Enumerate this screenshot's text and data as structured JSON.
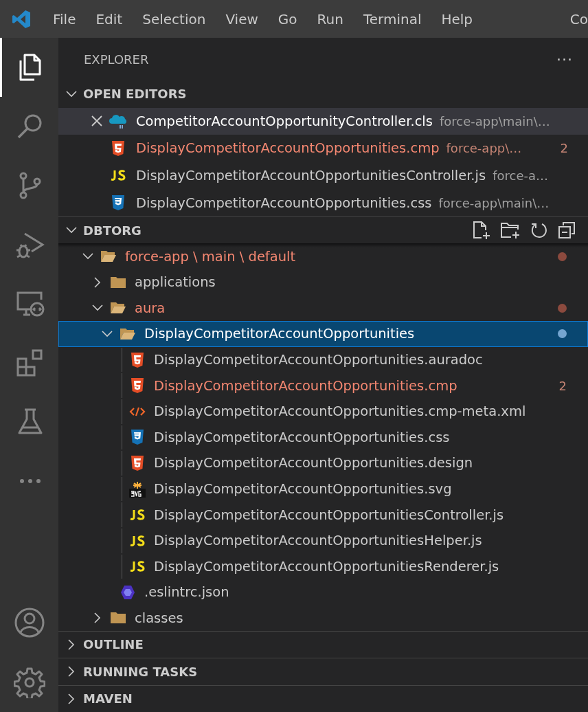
{
  "menu_bar": {
    "items": [
      "File",
      "Edit",
      "Selection",
      "View",
      "Go",
      "Run",
      "Terminal",
      "Help"
    ],
    "title": "Co"
  },
  "activity_bar": {
    "items": [
      {
        "kind": "explorer",
        "selected": true
      },
      {
        "kind": "search",
        "selected": false
      },
      {
        "kind": "source-control",
        "selected": false
      },
      {
        "kind": "run-debug",
        "selected": false
      },
      {
        "kind": "remote",
        "selected": false
      },
      {
        "kind": "extensions",
        "selected": false
      },
      {
        "kind": "testing",
        "selected": false
      },
      {
        "kind": "more",
        "selected": false
      }
    ],
    "bottom": [
      {
        "kind": "account"
      },
      {
        "kind": "settings"
      }
    ]
  },
  "sidebar": {
    "title": "EXPLORER",
    "more": "···",
    "open_editors": {
      "title": "OPEN EDITORS",
      "expanded": true,
      "items": [
        {
          "label": "CompetitorAccountOpportunityController.cls",
          "path": "force-app\\main\\…",
          "kind": "apex",
          "selected": true,
          "modified": false
        },
        {
          "label": "DisplayCompetitorAccountOpportunities.cmp",
          "path": "force-app\\…",
          "kind": "html",
          "selected": false,
          "modified": true,
          "badge": "2"
        },
        {
          "label": "DisplayCompetitorAccountOpportunitiesController.js",
          "path": "force-a…",
          "kind": "js",
          "selected": false,
          "modified": false
        },
        {
          "label": "DisplayCompetitorAccountOpportunities.css",
          "path": "force-app\\main\\…",
          "kind": "css",
          "selected": false,
          "modified": false
        }
      ]
    },
    "workspace": {
      "title": "DBTORG",
      "expanded": true,
      "tree": [
        {
          "label": "force-app \\ main \\ default",
          "kind": "folder",
          "expanded": true,
          "modified": true,
          "selected": false,
          "children": [
            {
              "label": "applications",
              "kind": "folder",
              "expanded": false,
              "modified": false,
              "selected": false
            },
            {
              "label": "aura",
              "kind": "folder",
              "expanded": true,
              "modified": true,
              "selected": false,
              "children": [
                {
                  "label": "DisplayCompetitorAccountOpportunities",
                  "kind": "folder",
                  "expanded": true,
                  "modified": true,
                  "selected": true,
                  "children": [
                    {
                      "label": "DisplayCompetitorAccountOpportunities.auradoc",
                      "kind": "html",
                      "modified": false,
                      "selected": false
                    },
                    {
                      "label": "DisplayCompetitorAccountOpportunities.cmp",
                      "kind": "html",
                      "modified": true,
                      "selected": false,
                      "badge": "2"
                    },
                    {
                      "label": "DisplayCompetitorAccountOpportunities.cmp-meta.xml",
                      "kind": "xml",
                      "modified": false,
                      "selected": false
                    },
                    {
                      "label": "DisplayCompetitorAccountOpportunities.css",
                      "kind": "css",
                      "modified": false,
                      "selected": false
                    },
                    {
                      "label": "DisplayCompetitorAccountOpportunities.design",
                      "kind": "html",
                      "modified": false,
                      "selected": false
                    },
                    {
                      "label": "DisplayCompetitorAccountOpportunities.svg",
                      "kind": "svg",
                      "modified": false,
                      "selected": false
                    },
                    {
                      "label": "DisplayCompetitorAccountOpportunitiesController.js",
                      "kind": "js",
                      "modified": false,
                      "selected": false
                    },
                    {
                      "label": "DisplayCompetitorAccountOpportunitiesHelper.js",
                      "kind": "js",
                      "modified": false,
                      "selected": false
                    },
                    {
                      "label": "DisplayCompetitorAccountOpportunitiesRenderer.js",
                      "kind": "js",
                      "modified": false,
                      "selected": false
                    }
                  ]
                },
                {
                  "label": ".eslintrc.json",
                  "kind": "eslint",
                  "modified": false,
                  "selected": false
                }
              ]
            },
            {
              "label": "classes",
              "kind": "folder",
              "expanded": false,
              "modified": false,
              "selected": false
            }
          ]
        }
      ]
    },
    "panels": [
      {
        "title": "OUTLINE",
        "expanded": false
      },
      {
        "title": "RUNNING TASKS",
        "expanded": false
      },
      {
        "title": "MAVEN",
        "expanded": false
      }
    ]
  }
}
